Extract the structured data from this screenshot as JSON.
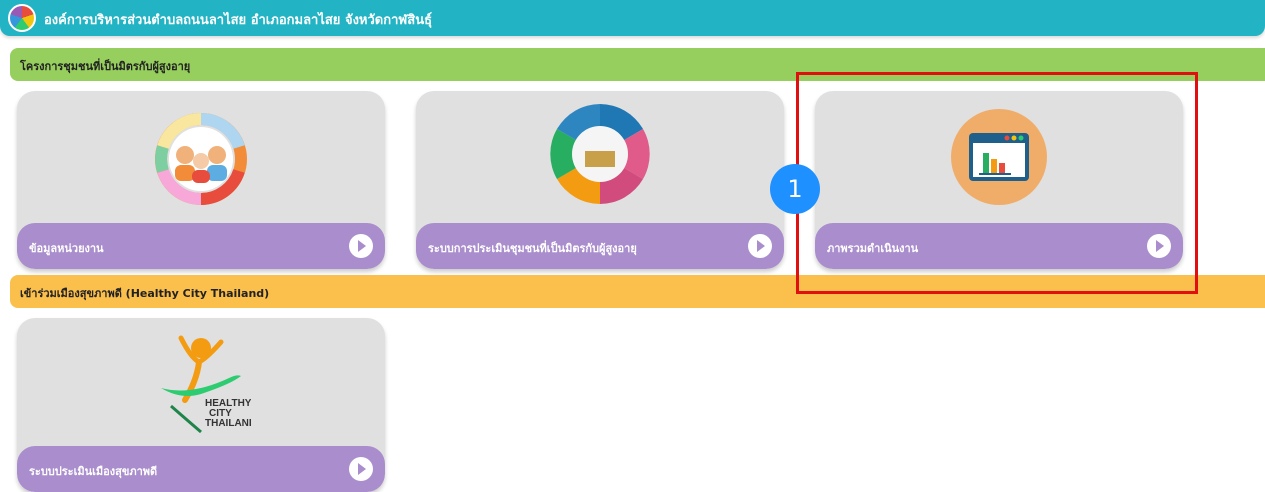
{
  "header": {
    "title": "องค์การบริหารส่วนตำบลถนนลาไสย อำเภอกมลาไสย จังหวัดกาฬสินธุ์"
  },
  "sections": [
    {
      "title": "โครงการชุมชนที่เป็นมิตรกับผู้สูงอายุ",
      "cards": [
        {
          "label": "ข้อมูลหน่วยงาน",
          "icon": "people-group-icon"
        },
        {
          "label": "ระบบการประเมินชุมชนที่เป็นมิตรกับผู้สูงอายุ",
          "icon": "assessment-wheel-icon"
        },
        {
          "label": "ภาพรวมดำเนินงาน",
          "icon": "bar-chart-window-icon"
        }
      ]
    },
    {
      "title": "เข้าร่วมเมืองสุขภาพดี (Healthy City Thailand)",
      "cards": [
        {
          "label": "ระบบประเมินเมืองสุขภาพดี",
          "icon": "healthy-city-logo"
        }
      ]
    }
  ],
  "healthy_logo": {
    "line1": "HEALTHY",
    "line2": "CITY",
    "line3": "THAILAND"
  },
  "annotation": {
    "number": "1"
  },
  "colors": {
    "header": "#22b4c4",
    "section1": "#97cf5e",
    "section2": "#fbbf4c",
    "card_footer": "#a98dcc",
    "highlight": "#e01010",
    "marker": "#1e90ff"
  }
}
